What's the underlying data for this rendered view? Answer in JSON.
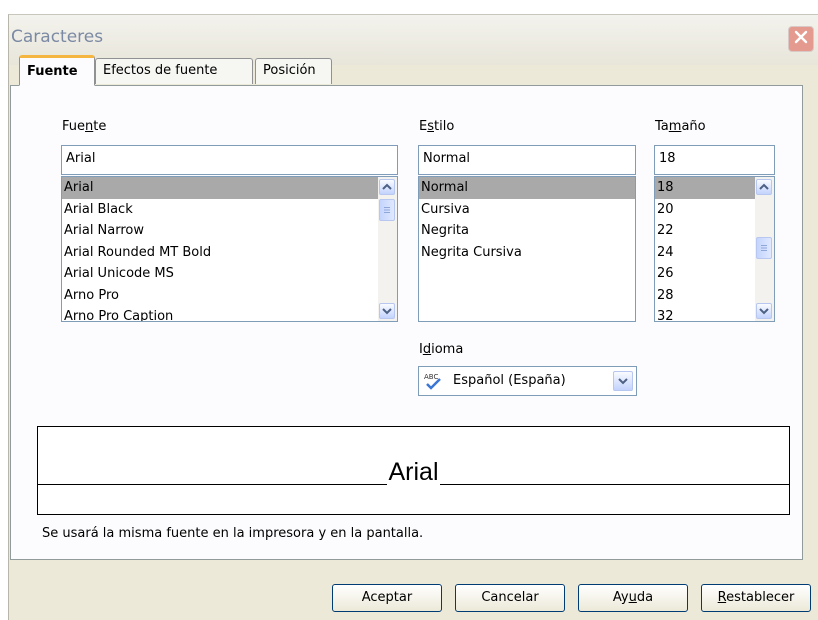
{
  "window": {
    "title": "Caracteres",
    "close_icon": "close-x-icon"
  },
  "tabs": [
    {
      "label": "Fuente",
      "active": true
    },
    {
      "label": "Efectos de fuente",
      "active": false
    },
    {
      "label": "Posición",
      "active": false
    }
  ],
  "font": {
    "label_pre": "Fue",
    "label_key": "n",
    "label_post": "te",
    "value": "Arial",
    "items": [
      "Arial",
      "Arial Black",
      "Arial Narrow",
      "Arial Rounded MT Bold",
      "Arial Unicode MS",
      "Arno Pro",
      "Arno Pro Caption"
    ],
    "selected": "Arial"
  },
  "style": {
    "label_pre": "E",
    "label_key": "s",
    "label_post": "tilo",
    "value": "Normal",
    "items": [
      "Normal",
      "Cursiva",
      "Negrita",
      "Negrita Cursiva"
    ],
    "selected": "Normal"
  },
  "size": {
    "label_pre": "Ta",
    "label_key": "m",
    "label_post": "año",
    "value": "18",
    "items": [
      "18",
      "20",
      "22",
      "24",
      "26",
      "28",
      "32"
    ],
    "selected": "18"
  },
  "language": {
    "label_pre": "I",
    "label_key": "d",
    "label_post": "ioma",
    "value": "Español (España)",
    "icon": "abc-spellcheck-icon"
  },
  "preview": {
    "text": "Arial"
  },
  "info": "Se usará la misma fuente en la impresora y en la pantalla.",
  "buttons": {
    "ok": "Aceptar",
    "cancel": "Cancelar",
    "help_pre": "Ay",
    "help_key": "u",
    "help_post": "da",
    "reset_key": "R",
    "reset_post": "establecer"
  }
}
